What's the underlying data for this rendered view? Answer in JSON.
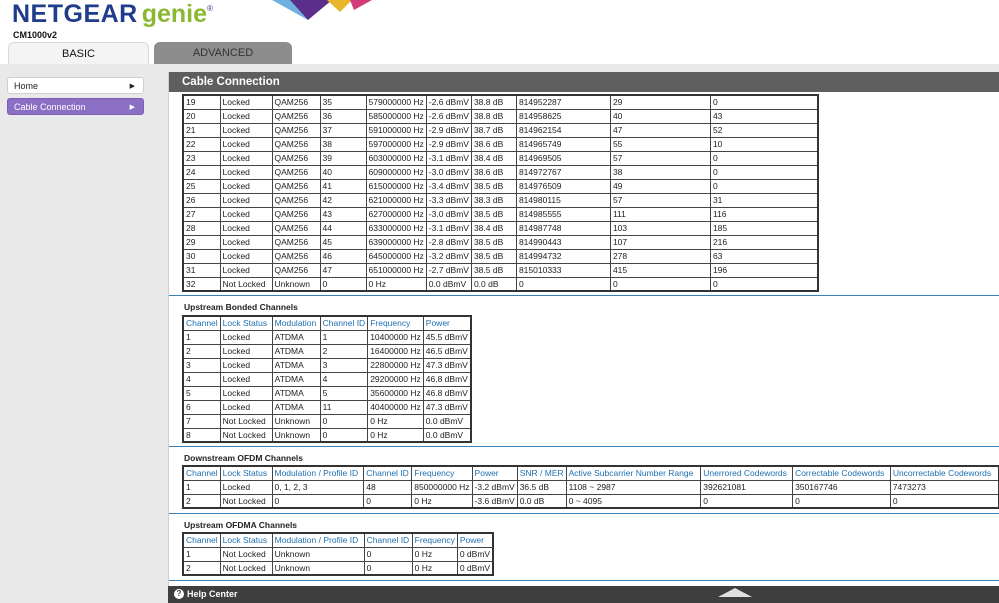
{
  "header": {
    "logo_netgear": "NETGEAR",
    "logo_genie": "genie",
    "logo_reg": "®",
    "model": "CM1000v2"
  },
  "tabs": [
    {
      "label": "BASIC"
    },
    {
      "label": "ADVANCED"
    }
  ],
  "sidebar": {
    "items": [
      {
        "label": "Home",
        "arrow": "▶"
      },
      {
        "label": "Cable Connection",
        "arrow": "▶"
      }
    ]
  },
  "main": {
    "title": "Cable Connection"
  },
  "downstream_bonded": {
    "rows": [
      [
        "19",
        "Locked",
        "QAM256",
        "35",
        "579000000 Hz",
        "-2.6 dBmV",
        "38.8 dB",
        "814952287",
        "29",
        "0"
      ],
      [
        "20",
        "Locked",
        "QAM256",
        "36",
        "585000000 Hz",
        "-2.6 dBmV",
        "38.8 dB",
        "814958625",
        "40",
        "43"
      ],
      [
        "21",
        "Locked",
        "QAM256",
        "37",
        "591000000 Hz",
        "-2.9 dBmV",
        "38.7 dB",
        "814962154",
        "47",
        "52"
      ],
      [
        "22",
        "Locked",
        "QAM256",
        "38",
        "597000000 Hz",
        "-2.9 dBmV",
        "38.6 dB",
        "814965749",
        "55",
        "10"
      ],
      [
        "23",
        "Locked",
        "QAM256",
        "39",
        "603000000 Hz",
        "-3.1 dBmV",
        "38.4 dB",
        "814969505",
        "57",
        "0"
      ],
      [
        "24",
        "Locked",
        "QAM256",
        "40",
        "609000000 Hz",
        "-3.0 dBmV",
        "38.6 dB",
        "814972767",
        "38",
        "0"
      ],
      [
        "25",
        "Locked",
        "QAM256",
        "41",
        "615000000 Hz",
        "-3.4 dBmV",
        "38.5 dB",
        "814976509",
        "49",
        "0"
      ],
      [
        "26",
        "Locked",
        "QAM256",
        "42",
        "621000000 Hz",
        "-3.3 dBmV",
        "38.3 dB",
        "814980115",
        "57",
        "31"
      ],
      [
        "27",
        "Locked",
        "QAM256",
        "43",
        "627000000 Hz",
        "-3.0 dBmV",
        "38.5 dB",
        "814985555",
        "111",
        "116"
      ],
      [
        "28",
        "Locked",
        "QAM256",
        "44",
        "633000000 Hz",
        "-3.1 dBmV",
        "38.4 dB",
        "814987748",
        "103",
        "185"
      ],
      [
        "29",
        "Locked",
        "QAM256",
        "45",
        "639000000 Hz",
        "-2.8 dBmV",
        "38.5 dB",
        "814990443",
        "107",
        "216"
      ],
      [
        "30",
        "Locked",
        "QAM256",
        "46",
        "645000000 Hz",
        "-3.2 dBmV",
        "38.5 dB",
        "814994732",
        "278",
        "63"
      ],
      [
        "31",
        "Locked",
        "QAM256",
        "47",
        "651000000 Hz",
        "-2.7 dBmV",
        "38.5 dB",
        "815010333",
        "415",
        "196"
      ],
      [
        "32",
        "Not Locked",
        "Unknown",
        "0",
        "0 Hz",
        "0.0 dBmV",
        "0.0 dB",
        "0",
        "0",
        "0"
      ]
    ]
  },
  "upstream_bonded": {
    "title": "Upstream Bonded Channels",
    "headers": [
      "Channel",
      "Lock Status",
      "Modulation",
      "Channel ID",
      "Frequency",
      "Power"
    ],
    "rows": [
      [
        "1",
        "Locked",
        "ATDMA",
        "1",
        "10400000 Hz",
        "45.5 dBmV"
      ],
      [
        "2",
        "Locked",
        "ATDMA",
        "2",
        "16400000 Hz",
        "46.5 dBmV"
      ],
      [
        "3",
        "Locked",
        "ATDMA",
        "3",
        "22800000 Hz",
        "47.3 dBmV"
      ],
      [
        "4",
        "Locked",
        "ATDMA",
        "4",
        "29200000 Hz",
        "46.8 dBmV"
      ],
      [
        "5",
        "Locked",
        "ATDMA",
        "5",
        "35600000 Hz",
        "46.8 dBmV"
      ],
      [
        "6",
        "Locked",
        "ATDMA",
        "11",
        "40400000 Hz",
        "47.3 dBmV"
      ],
      [
        "7",
        "Not Locked",
        "Unknown",
        "0",
        "0 Hz",
        "0.0 dBmV"
      ],
      [
        "8",
        "Not Locked",
        "Unknown",
        "0",
        "0 Hz",
        "0.0 dBmV"
      ]
    ]
  },
  "downstream_ofdm": {
    "title": "Downstream OFDM Channels",
    "headers": [
      "Channel",
      "Lock Status",
      "Modulation / Profile ID",
      "Channel ID",
      "Frequency",
      "Power",
      "SNR / MER",
      "Active Subcarrier Number Range",
      "Unerrored Codewords",
      "Correctable Codewords",
      "Uncorrectable Codewords"
    ],
    "rows": [
      [
        "1",
        "Locked",
        "0, 1, 2, 3",
        "48",
        "850000000 Hz",
        "-3.2 dBmV",
        "36.5 dB",
        "1108 ~ 2987",
        "392621081",
        "350167746",
        "7473273"
      ],
      [
        "2",
        "Not Locked",
        "0",
        "0",
        "0 Hz",
        "-3.6 dBmV",
        "0.0 dB",
        "0 ~ 4095",
        "0",
        "0",
        "0"
      ]
    ]
  },
  "upstream_ofdma": {
    "title": "Upstream OFDMA Channels",
    "headers": [
      "Channel",
      "Lock Status",
      "Modulation / Profile ID",
      "Channel ID",
      "Frequency",
      "Power"
    ],
    "rows": [
      [
        "1",
        "Not Locked",
        "Unknown",
        "0",
        "0 Hz",
        "0 dBmV"
      ],
      [
        "2",
        "Not Locked",
        "Unknown",
        "0",
        "0 Hz",
        "0 dBmV"
      ]
    ]
  },
  "helpbar": {
    "icon": "?",
    "label": "Help Center"
  },
  "colors": {
    "accent": "#8a6fc4",
    "header_blue": "#1d6fb0",
    "logo_blue": "#1f3d8a",
    "logo_green": "#8bb833"
  }
}
